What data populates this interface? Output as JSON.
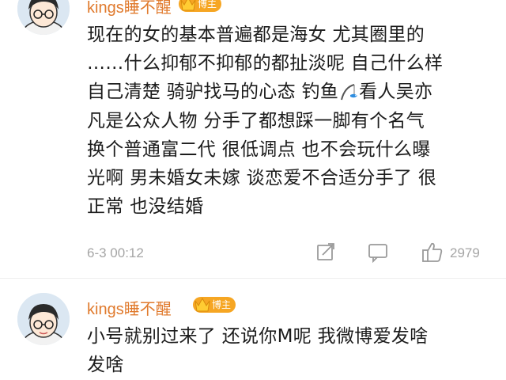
{
  "comments": [
    {
      "username": "kings睡不醒",
      "badge": "博主",
      "lines": [
        "现在的女的基本普遍都是海女 尤其圈里的",
        "……什么抑郁不抑郁的都扯淡呢 自己什么样",
        "自己清楚 骑驴找马的心态 钓鱼",
        "看人吴亦",
        "凡是公众人物 分手了都想踩一脚有个名气",
        "换个普通富二代 很低调点 也不会玩什么曝",
        "光啊 男未婚女未嫁 谈恋爱不合适分手了 很",
        "正常 也没结婚"
      ],
      "timestamp": "6-3 00:12",
      "like_count": "2979"
    },
    {
      "username": "kings睡不醒",
      "badge": "博主",
      "lines": [
        "小号就别过来了 还说你M呢 我微博爱发啥",
        "发啥"
      ]
    }
  ],
  "icons": {
    "share": "share-icon",
    "comment": "comment-icon",
    "like": "thumbs-up-icon",
    "fishing": "fishing-rod-emoji"
  },
  "colors": {
    "username": "#e07a2d",
    "badge": "#f6a623",
    "meta": "#a5a5a5",
    "text": "#1c1c1c"
  }
}
